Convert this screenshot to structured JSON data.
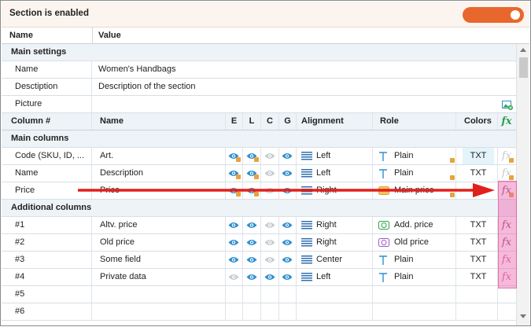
{
  "topbar": {
    "title": "Section is enabled",
    "toggle_on": true
  },
  "header": {
    "name": "Name",
    "value": "Value"
  },
  "main_settings": {
    "title": "Main settings",
    "rows": [
      {
        "name": "Name",
        "value": "Women's Handbags"
      },
      {
        "name": "Desctiption",
        "value": "Description of the section"
      },
      {
        "name": "Picture",
        "value": ""
      }
    ]
  },
  "columns_header": {
    "col": "Column #",
    "name": "Name",
    "e": "E",
    "l": "L",
    "c": "C",
    "g": "G",
    "alignment": "Alignment",
    "role": "Role",
    "colors": "Colors",
    "fx": "fx"
  },
  "main_columns": {
    "title": "Main columns",
    "rows": [
      {
        "col": "Code (SKU, ID, ...",
        "name": "Art.",
        "alignment": "Left",
        "role": "Plain",
        "colors": "TXT"
      },
      {
        "col": "Name",
        "name": "Description",
        "alignment": "Left",
        "role": "Plain",
        "colors": "TXT"
      },
      {
        "col": "Price",
        "name": "Price",
        "alignment": "Right",
        "role": "Main price",
        "colors": ""
      }
    ]
  },
  "additional_columns": {
    "title": "Additional columns",
    "rows": [
      {
        "col": "#1",
        "name": "Altv. price",
        "alignment": "Right",
        "role": "Add. price",
        "colors": "TXT"
      },
      {
        "col": "#2",
        "name": "Old price",
        "alignment": "Right",
        "role": "Old price",
        "colors": "TXT"
      },
      {
        "col": "#3",
        "name": "Some field",
        "alignment": "Center",
        "role": "Plain",
        "colors": "TXT"
      },
      {
        "col": "#4",
        "name": "Private data",
        "alignment": "Left",
        "role": "Plain",
        "colors": "TXT"
      },
      {
        "col": "#5",
        "name": ""
      },
      {
        "col": "#6",
        "name": ""
      }
    ]
  },
  "colors": {
    "accent": "#e8672c",
    "eye_blue": "#2f8fcf",
    "eye_gray": "#c8ccd0",
    "arrow": "#e0201a",
    "highlight": "#ec64aa",
    "fx_green": "#2aa34a"
  },
  "icons": [
    "eye-icon",
    "lock-icon",
    "align-lines-icon",
    "text-role-icon",
    "price-role-icon",
    "image-picker-icon",
    "formula-icon"
  ]
}
